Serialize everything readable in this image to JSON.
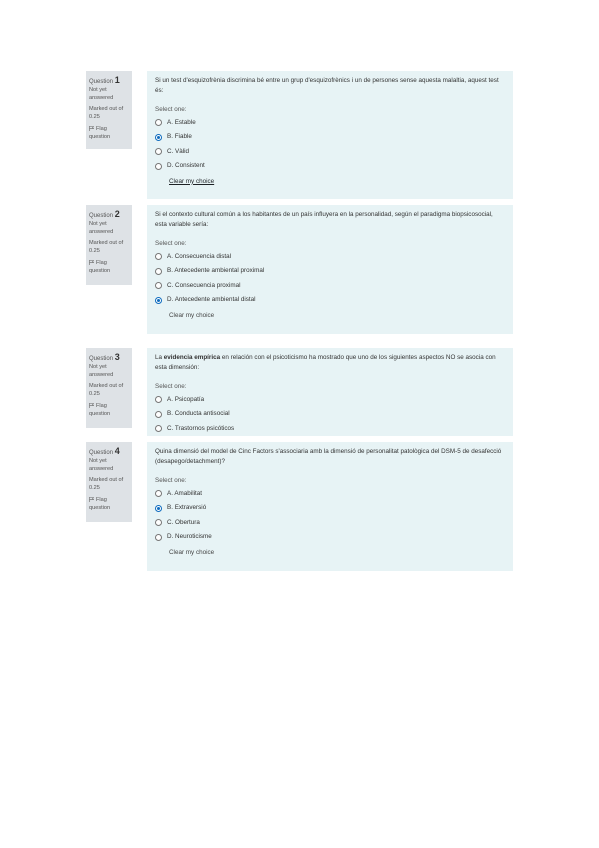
{
  "colors": {
    "content_bg": "#e7f3f5",
    "info_bg": "#dee2e6",
    "selected_radio": "#0f6cbf"
  },
  "questions": [
    {
      "label": "Question",
      "number": "1",
      "state": "Not yet answered",
      "grade": "Marked out of 0.25",
      "flag": "Flag question",
      "text_before": "Si un test d'esquizofrènia discrimina bé entre un grup d'esquizofrènics i un de persones sense aquesta malaltia, aquest test és:",
      "bold": "",
      "text_after": "",
      "prompt": "Select one:",
      "options": [
        "A. Estable",
        "B. Fiable",
        "C. Vàlid",
        "D. Consistent"
      ],
      "selected": 1,
      "clear": "Clear my choice"
    },
    {
      "label": "Question",
      "number": "2",
      "state": "Not yet answered",
      "grade": "Marked out of 0.25",
      "flag": "Flag question",
      "text_before": "Si el contexto cultural común a los habitantes de un país influyera en la personalidad, según el paradigma biopsicosocial, esta variable sería:",
      "bold": "",
      "text_after": "",
      "prompt": "Select one:",
      "options": [
        "A. Consecuencia distal",
        "B. Antecedente ambiental proximal",
        "C. Consecuencia proximal",
        "D. Antecedente ambiental distal"
      ],
      "selected": 3,
      "clear": "Clear my choice"
    },
    {
      "label": "Question",
      "number": "3",
      "state": "Not yet answered",
      "grade": "Marked out of 0.25",
      "flag": "Flag question",
      "text_before": "La ",
      "bold": "evidencia empírica",
      "text_after": " en relación con el psicoticismo ha mostrado que uno de los siguientes aspectos NO se asocia con esta dimensión:",
      "prompt": "Select one:",
      "options": [
        "A. Psicopatía",
        "B. Conducta antisocial",
        "C. Trastornos psicóticos"
      ],
      "selected": -1,
      "clear": ""
    },
    {
      "label": "Question",
      "number": "4",
      "state": "Not yet answered",
      "grade": "Marked out of 0.25",
      "flag": "Flag question",
      "text_before": "Quina dimensió del model de Cinc Factors s'associaria amb la dimensió de personalitat patològica del DSM-5 de desafecció (desapego/detachment)?",
      "bold": "",
      "text_after": "",
      "prompt": "Select one:",
      "options": [
        "A. Amabilitat",
        "B. Extraversió",
        "C. Obertura",
        "D. Neuroticisme"
      ],
      "selected": 1,
      "clear": "Clear my choice"
    }
  ]
}
